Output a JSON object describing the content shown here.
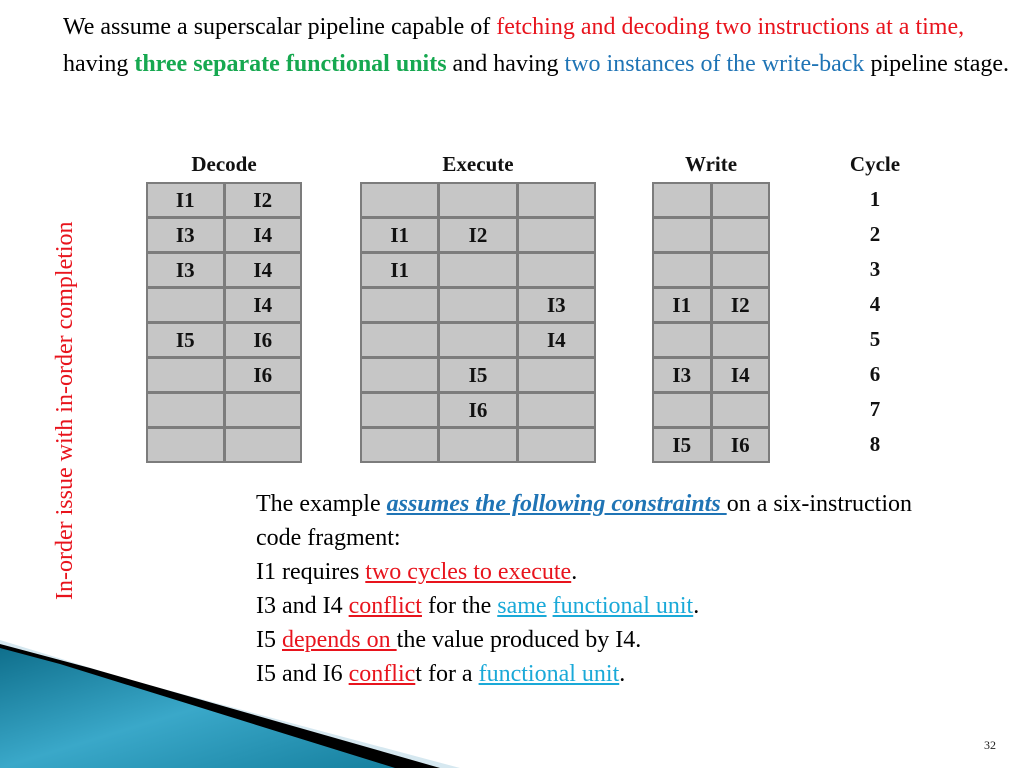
{
  "intro": {
    "segments": [
      {
        "text": "We assume a superscalar pipeline capable of ",
        "style": "plain"
      },
      {
        "text": "fetching and decoding two instructions at a time,",
        "style": "red"
      },
      {
        "text": " having ",
        "style": "plain"
      },
      {
        "text": "three separate functional units",
        "style": "green"
      },
      {
        "text": " and having ",
        "style": "plain"
      },
      {
        "text": "two instances of the write-back",
        "style": "blue"
      },
      {
        "text": " pipeline stage.",
        "style": "plain"
      }
    ]
  },
  "side_label": "In-order issue with in-order completion",
  "pipeline": {
    "decode": {
      "title": "Decode",
      "rows": [
        [
          "I1",
          "I2"
        ],
        [
          "I3",
          "I4"
        ],
        [
          "I3",
          "I4"
        ],
        [
          "",
          "I4"
        ],
        [
          "I5",
          "I6"
        ],
        [
          "",
          "I6"
        ],
        [
          "",
          ""
        ],
        [
          "",
          ""
        ]
      ]
    },
    "execute": {
      "title": "Execute",
      "rows": [
        [
          "",
          "",
          ""
        ],
        [
          "I1",
          "I2",
          ""
        ],
        [
          "I1",
          "",
          ""
        ],
        [
          "",
          "",
          "I3"
        ],
        [
          "",
          "",
          "I4"
        ],
        [
          "",
          "I5",
          ""
        ],
        [
          "",
          "I6",
          ""
        ],
        [
          "",
          "",
          ""
        ]
      ]
    },
    "write": {
      "title": "Write",
      "rows": [
        [
          "",
          ""
        ],
        [
          "",
          ""
        ],
        [
          "",
          ""
        ],
        [
          "I1",
          "I2"
        ],
        [
          "",
          ""
        ],
        [
          "I3",
          "I4"
        ],
        [
          "",
          ""
        ],
        [
          "I5",
          "I6"
        ]
      ]
    },
    "cycle": {
      "title": "Cycle",
      "values": [
        "1",
        "2",
        "3",
        "4",
        "5",
        "6",
        "7",
        "8"
      ]
    }
  },
  "constraints": {
    "lines": [
      [
        {
          "text": "The example ",
          "style": "plain"
        },
        {
          "text": "assumes the following constraints ",
          "style": "u-blue-bold"
        },
        {
          "text": "on a six-instruction code fragment:",
          "style": "plain"
        }
      ],
      [
        {
          "text": "I1 requires ",
          "style": "plain"
        },
        {
          "text": "two cycles to execute",
          "style": "u-red"
        },
        {
          "text": ".",
          "style": "plain"
        }
      ],
      [
        {
          "text": "I3 and I4 ",
          "style": "plain"
        },
        {
          "text": "conflict",
          "style": "u-red"
        },
        {
          "text": " for the ",
          "style": "plain"
        },
        {
          "text": "same",
          "style": "u-cyan"
        },
        {
          "text": " ",
          "style": "plain"
        },
        {
          "text": "functional unit",
          "style": "u-cyan"
        },
        {
          "text": ".",
          "style": "plain"
        }
      ],
      [
        {
          "text": "I5 ",
          "style": "plain"
        },
        {
          "text": "depends on ",
          "style": "u-red"
        },
        {
          "text": "the value produced by I4.",
          "style": "plain"
        }
      ],
      [
        {
          "text": "I5 and I6 ",
          "style": "plain"
        },
        {
          "text": "conflic",
          "style": "u-red"
        },
        {
          "text": "t for a ",
          "style": "plain"
        },
        {
          "text": "functional unit",
          "style": "u-cyan"
        },
        {
          "text": ".",
          "style": "plain"
        }
      ]
    ]
  },
  "page_number": "32",
  "colors": {
    "red": "#e8141d",
    "green": "#16a850",
    "blue": "#1f74b5",
    "cyan": "#1aa9d8",
    "cell_fill": "#c6c6c6",
    "cell_border": "#7c7c7c",
    "deco_teal": "#1d8fb0"
  }
}
